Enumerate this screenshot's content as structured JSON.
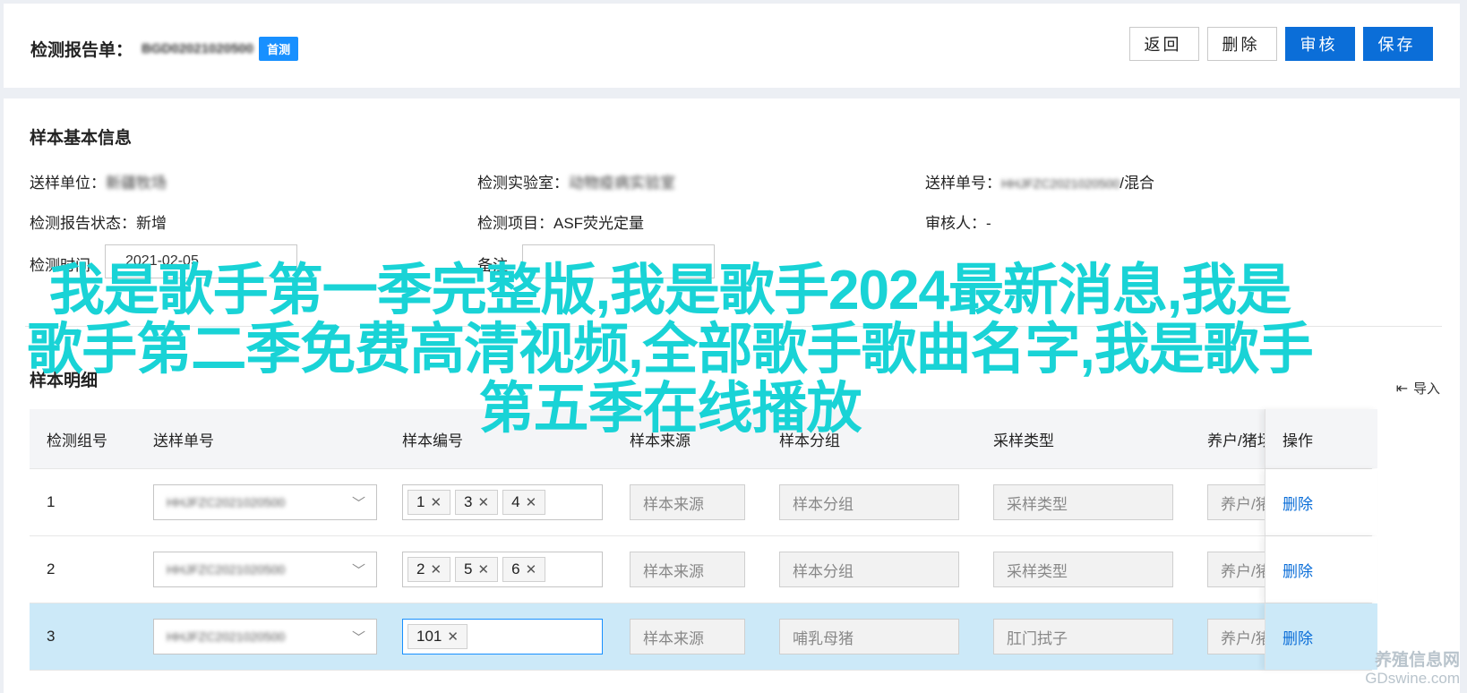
{
  "header": {
    "title_label": "检测报告单：",
    "report_code": "BGD02021020500",
    "badge": "首测",
    "buttons": {
      "back": "返回",
      "delete": "删除",
      "review": "审核",
      "save": "保存"
    }
  },
  "sample_info": {
    "section_title": "样本基本信息",
    "submit_unit": {
      "label": "送样单位：",
      "value": "新疆牧场"
    },
    "lab": {
      "label": "检测实验室：",
      "value": "动物疫病实验室"
    },
    "submit_no": {
      "label": "送样单号：",
      "value": "HHJFZC2021020500",
      "suffix": "/混合"
    },
    "report_status": {
      "label": "检测报告状态：",
      "value": "新增"
    },
    "test_item": {
      "label": "检测项目：",
      "value": "ASF荧光定量"
    },
    "reviewer": {
      "label": "审核人：",
      "value": "-"
    },
    "test_time": {
      "label": "检测时间",
      "value": "2021-02-05"
    },
    "remark": {
      "label": "备注",
      "value": ""
    }
  },
  "detail": {
    "section_title": "样本明细",
    "import_label": "导入",
    "columns": [
      "检测组号",
      "送样单号",
      "样本编号",
      "样本来源",
      "样本分组",
      "采样类型",
      "养户/猪场",
      "操作"
    ],
    "rows": [
      {
        "group": "1",
        "submit_no": "HHJFZC2021020500",
        "tags": [
          "1",
          "3",
          "4"
        ],
        "source": "样本来源",
        "grouping": "样本分组",
        "sample_type": "采样类型",
        "farm": "养户/猪场",
        "action": "删除",
        "selected": false
      },
      {
        "group": "2",
        "submit_no": "HHJFZC2021020500",
        "tags": [
          "2",
          "5",
          "6"
        ],
        "source": "样本来源",
        "grouping": "样本分组",
        "sample_type": "采样类型",
        "farm": "养户/猪场",
        "action": "删除",
        "selected": false
      },
      {
        "group": "3",
        "submit_no": "HHJFZC2021020500",
        "tags": [
          "101"
        ],
        "source": "样本来源",
        "grouping": "哺乳母猪",
        "sample_type": "肛门拭子",
        "farm": "养户/猪场",
        "action": "删除",
        "selected": true
      }
    ]
  },
  "overlay_text": "我是歌手第一季完整版,我是歌手2024最新消息,我是歌手第二季免费高清视频,全部歌手歌曲名字,我是歌手第五季在线播放",
  "watermark": {
    "line1": "养殖信息网",
    "line2": "GDswine.com"
  }
}
